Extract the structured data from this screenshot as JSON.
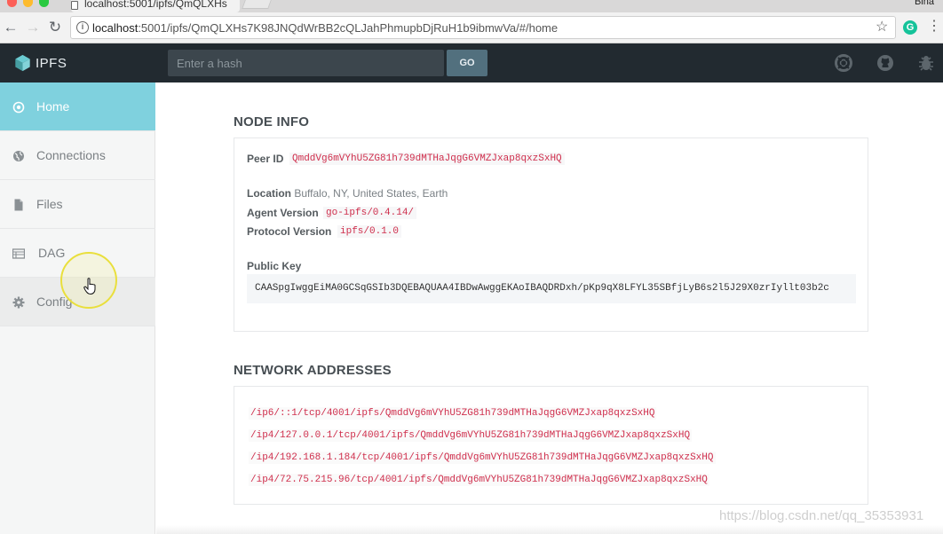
{
  "browser": {
    "tab_title": "localhost:5001/ipfs/QmQLXHs",
    "user_name": "Bina",
    "url_host": "localhost",
    "url_rest": ":5001/ipfs/QmQLXHs7K98JNQdWrBB2cQLJahPhmupbDjRuH1b9ibmwVa/#/home"
  },
  "header": {
    "logo_text": "IPFS",
    "hash_placeholder": "Enter a hash",
    "go_label": "GO"
  },
  "sidebar": {
    "items": [
      {
        "label": "Home",
        "icon": "home-icon",
        "active": true
      },
      {
        "label": "Connections",
        "icon": "globe-icon",
        "active": false
      },
      {
        "label": "Files",
        "icon": "file-icon",
        "active": false
      },
      {
        "label": "DAG",
        "icon": "dag-icon",
        "active": false
      },
      {
        "label": "Config",
        "icon": "gear-icon",
        "active": false
      }
    ]
  },
  "node_info": {
    "title": "NODE INFO",
    "peer_id_label": "Peer ID",
    "peer_id": "QmddVg6mVYhU5ZG81h739dMTHaJqgG6VMZJxap8qxzSxHQ",
    "location_label": "Location",
    "location": "Buffalo, NY, United States, Earth",
    "agent_label": "Agent Version",
    "agent": "go-ipfs/0.4.14/",
    "protocol_label": "Protocol Version",
    "protocol": "ipfs/0.1.0",
    "pubkey_label": "Public Key",
    "pubkey": "CAASpgIwggEiMA0GCSqGSIb3DQEBAQUAA4IBDwAwggEKAoIBAQDRDxh/pKp9qX8LFYL35SBfjLyB6s2l5J29X0zrIyllt03b2c"
  },
  "network": {
    "title": "NETWORK ADDRESSES",
    "addresses": [
      "/ip6/::1/tcp/4001/ipfs/QmddVg6mVYhU5ZG81h739dMTHaJqgG6VMZJxap8qxzSxHQ",
      "/ip4/127.0.0.1/tcp/4001/ipfs/QmddVg6mVYhU5ZG81h739dMTHaJqgG6VMZJxap8qxzSxHQ",
      "/ip4/192.168.1.184/tcp/4001/ipfs/QmddVg6mVYhU5ZG81h739dMTHaJqgG6VMZJxap8qxzSxHQ",
      "/ip4/72.75.215.96/tcp/4001/ipfs/QmddVg6mVYhU5ZG81h739dMTHaJqgG6VMZJxap8qxzSxHQ"
    ]
  },
  "watermark": "https://blog.csdn.net/qq_35353931",
  "colors": {
    "header_bg": "#222a30",
    "active_item": "#7fd1de",
    "code_red": "#cf2e4c"
  }
}
